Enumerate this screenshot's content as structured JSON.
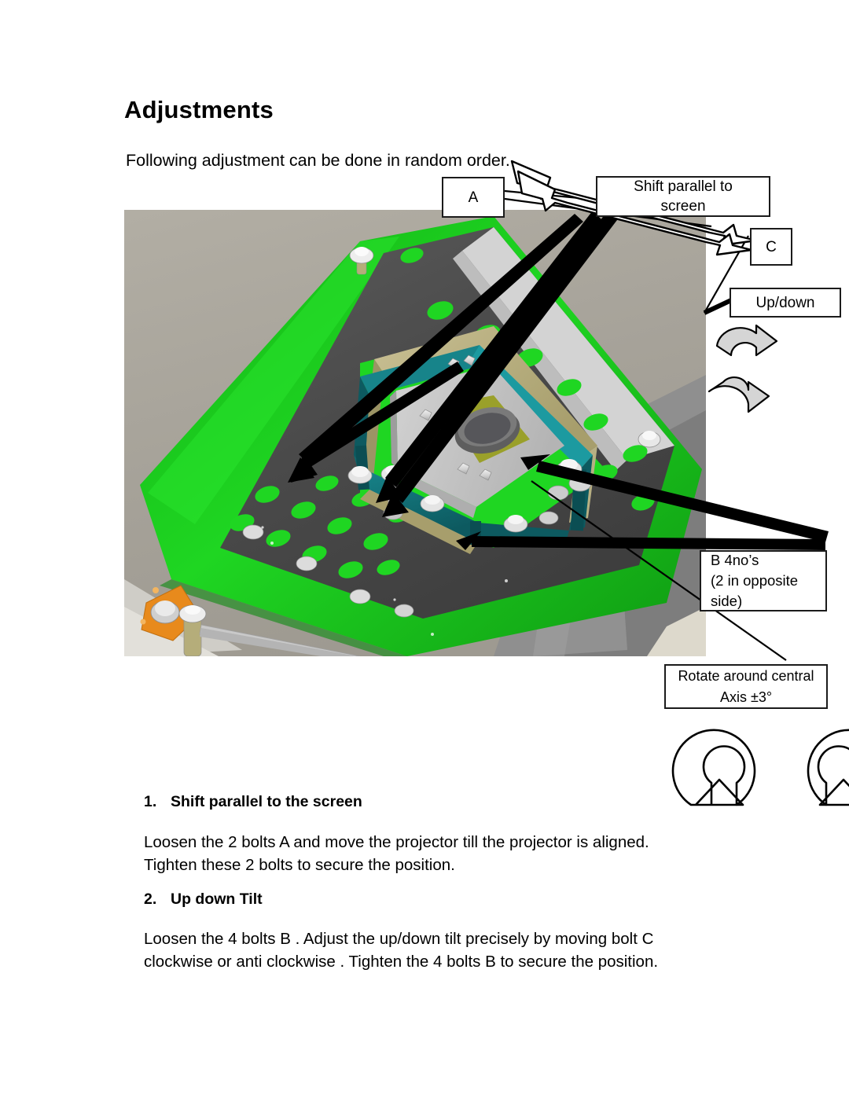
{
  "document": {
    "title": "Adjustments",
    "intro": "Following adjustment can be done in random order."
  },
  "callouts": {
    "a": "A",
    "shift_parallel": "Shift parallel to\nscreen",
    "c": "C",
    "up_down": "Up/down",
    "b_bolts": "B 4no’s\n(2 in opposite\nside)",
    "rotate": "Rotate around central\nAxis  ±3°"
  },
  "steps": [
    {
      "number": "1.",
      "heading": "Shift parallel to the screen",
      "body": "Loosen the 2 bolts A and move the projector till the projector is aligned.\nTighten these 2 bolts to secure the position."
    },
    {
      "number": "2.",
      "heading": "Up down Tilt",
      "body": "Loosen the 4 bolts B . Adjust the up/down tilt precisely by moving bolt C\nclockwise or anti clockwise . Tighten the 4 bolts B to secure the position."
    }
  ],
  "figure": {
    "description": "CAD render of projector mounting plate assembly",
    "colors": {
      "background": "#a6a299",
      "body_green": "#18c81c",
      "plate_gray": "#4a4a4a",
      "frame_teal": "#126b70",
      "rail_tan": "#b5ad7a",
      "center_gray": "#c9c9c9",
      "bolt_silver": "#d8d8d8",
      "bracket_orange": "#e88a1c",
      "olive": "#9aa02a",
      "light_gray_panel": "#c2c2c2"
    }
  }
}
